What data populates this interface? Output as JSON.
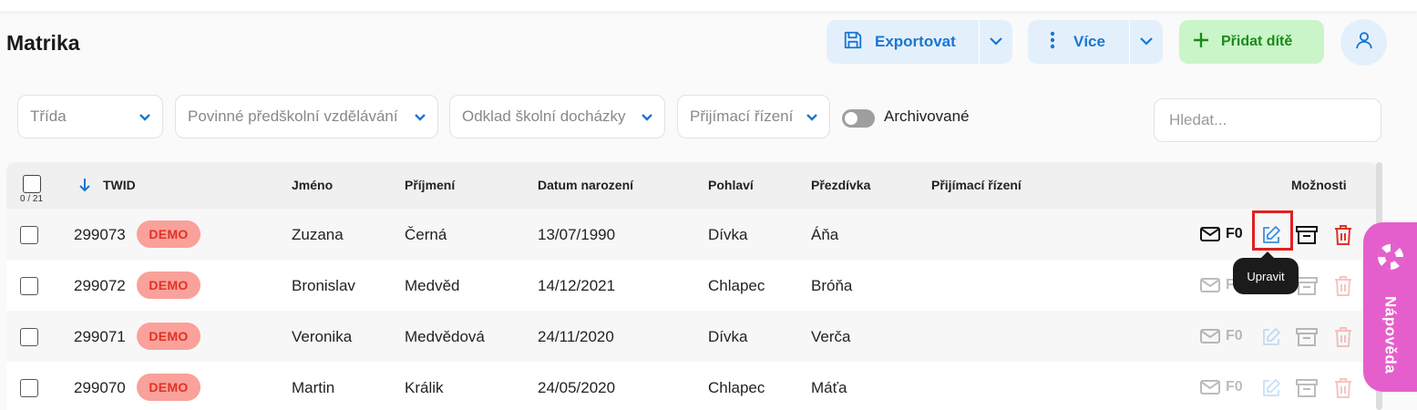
{
  "page": {
    "title": "Matrika"
  },
  "toolbar": {
    "export_label": "Exportovat",
    "more_label": "Více",
    "add_label": "Přidat dítě"
  },
  "filters": {
    "class": "Třída",
    "compulsory": "Povinné předškolní vzdělávání",
    "deferral": "Odklad školní docházky",
    "admission": "Přijímací řízení",
    "archived_label": "Archivované",
    "archived_on": false
  },
  "search": {
    "placeholder": "Hledat...",
    "value": ""
  },
  "table": {
    "selected_count": "0 / 21",
    "headers": {
      "twid": "TWID",
      "first_name": "Jméno",
      "last_name": "Příjmení",
      "birth_date": "Datum narození",
      "gender": "Pohlaví",
      "nickname": "Přezdívka",
      "admission": "Přijímací řízení",
      "options": "Možnosti"
    },
    "demo_badge": "DEMO",
    "f0_label": "F0",
    "rows": [
      {
        "twid": "299073",
        "first_name": "Zuzana",
        "last_name": "Černá",
        "birth_date": "13/07/1990",
        "gender": "Dívka",
        "nickname": "Áňa",
        "admission": ""
      },
      {
        "twid": "299072",
        "first_name": "Bronislav",
        "last_name": "Medvěd",
        "birth_date": "14/12/2021",
        "gender": "Chlapec",
        "nickname": "Bróňa",
        "admission": ""
      },
      {
        "twid": "299071",
        "first_name": "Veronika",
        "last_name": "Medvědová",
        "birth_date": "24/11/2020",
        "gender": "Dívka",
        "nickname": "Verča",
        "admission": ""
      },
      {
        "twid": "299070",
        "first_name": "Martin",
        "last_name": "Králik",
        "birth_date": "24/05/2020",
        "gender": "Chlapec",
        "nickname": "Máťa",
        "admission": ""
      }
    ]
  },
  "tooltip": {
    "text": "Upravit"
  },
  "help": {
    "label": "Nápověda"
  },
  "colors": {
    "accent_blue": "#1976d2",
    "green": "#1b8a1b",
    "danger": "#e03227",
    "help_pink": "#e55fcc"
  }
}
